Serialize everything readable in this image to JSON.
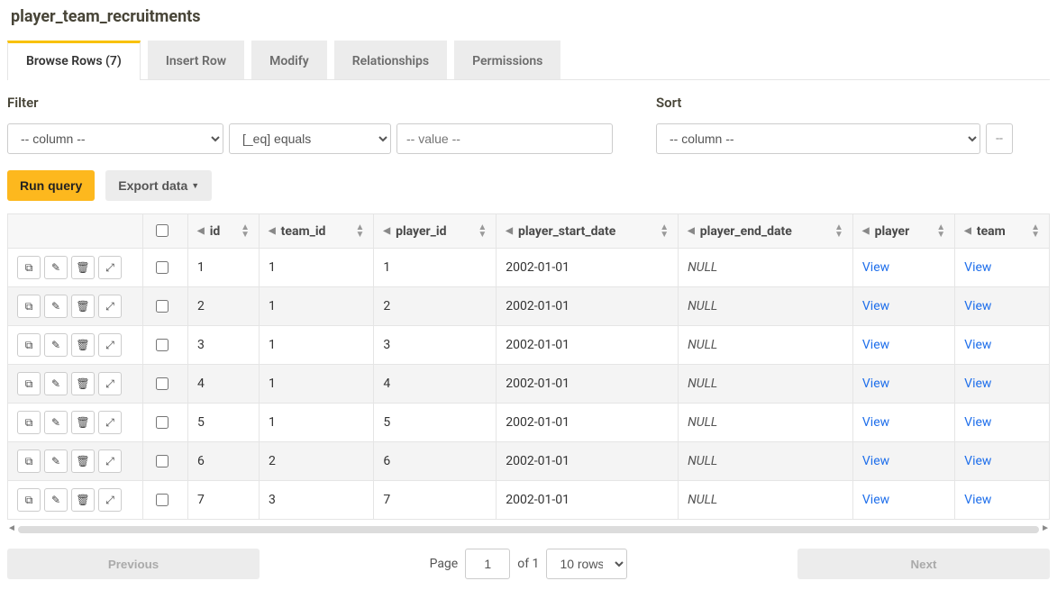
{
  "title": "player_team_recruitments",
  "tabs": [
    {
      "label": "Browse Rows (7)",
      "active": true
    },
    {
      "label": "Insert Row",
      "active": false
    },
    {
      "label": "Modify",
      "active": false
    },
    {
      "label": "Relationships",
      "active": false
    },
    {
      "label": "Permissions",
      "active": false
    }
  ],
  "filter": {
    "label": "Filter",
    "column_placeholder": "-- column --",
    "operator": "[_eq] equals",
    "value_placeholder": "-- value --"
  },
  "sort": {
    "label": "Sort",
    "column_placeholder": "-- column --",
    "dash": "--"
  },
  "buttons": {
    "run_query": "Run query",
    "export_data": "Export data"
  },
  "columns": [
    "id",
    "team_id",
    "player_id",
    "player_start_date",
    "player_end_date",
    "player",
    "team"
  ],
  "rows": [
    {
      "id": "1",
      "team_id": "1",
      "player_id": "1",
      "player_start_date": "2002-01-01",
      "player_end_date": null,
      "player": "View",
      "team": "View"
    },
    {
      "id": "2",
      "team_id": "1",
      "player_id": "2",
      "player_start_date": "2002-01-01",
      "player_end_date": null,
      "player": "View",
      "team": "View"
    },
    {
      "id": "3",
      "team_id": "1",
      "player_id": "3",
      "player_start_date": "2002-01-01",
      "player_end_date": null,
      "player": "View",
      "team": "View"
    },
    {
      "id": "4",
      "team_id": "1",
      "player_id": "4",
      "player_start_date": "2002-01-01",
      "player_end_date": null,
      "player": "View",
      "team": "View"
    },
    {
      "id": "5",
      "team_id": "1",
      "player_id": "5",
      "player_start_date": "2002-01-01",
      "player_end_date": null,
      "player": "View",
      "team": "View"
    },
    {
      "id": "6",
      "team_id": "2",
      "player_id": "6",
      "player_start_date": "2002-01-01",
      "player_end_date": null,
      "player": "View",
      "team": "View"
    },
    {
      "id": "7",
      "team_id": "3",
      "player_id": "7",
      "player_start_date": "2002-01-01",
      "player_end_date": null,
      "player": "View",
      "team": "View"
    }
  ],
  "null_text": "NULL",
  "pager": {
    "previous": "Previous",
    "next": "Next",
    "page_label": "Page",
    "page": "1",
    "of_label": "of 1",
    "rows_option": "10 rows"
  }
}
